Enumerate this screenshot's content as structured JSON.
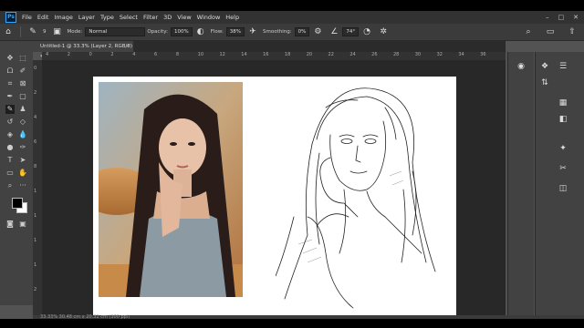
{
  "app": {
    "logo_text": "Ps",
    "menu": [
      "File",
      "Edit",
      "Image",
      "Layer",
      "Type",
      "Select",
      "Filter",
      "3D",
      "View",
      "Window",
      "Help"
    ],
    "window_controls": [
      "–",
      "□",
      "✕"
    ]
  },
  "options": {
    "brush_size": "9",
    "mode_label": "Mode:",
    "mode_value": "Normal",
    "opacity_label": "Opacity:",
    "opacity_value": "100%",
    "flow_label": "Flow:",
    "flow_value": "38%",
    "smoothing_label": "Smoothing:",
    "smoothing_value": "0%",
    "angle_value": "74°"
  },
  "document": {
    "tab_title": "Untitled-1 @ 33.3% (Layer 2, RGB/8) *",
    "tab_close": "×"
  },
  "ruler": {
    "top_ticks": [
      "4",
      "2",
      "0",
      "2",
      "4",
      "6",
      "8",
      "10",
      "12",
      "14",
      "16",
      "18",
      "20",
      "22",
      "24",
      "26",
      "28",
      "30",
      "32",
      "34",
      "36"
    ],
    "left_ticks": [
      "0",
      "2",
      "4",
      "6",
      "8",
      "1",
      "1",
      "1",
      "1",
      "2"
    ]
  },
  "status": {
    "text": "33.33%    30.48 cm x 20.32 cm (300 ppi)"
  },
  "icons": {
    "home": "home-icon",
    "brush": "brush-icon",
    "pressure": "pressure-icon",
    "airbrush": "airbrush-icon",
    "settings": "gear-icon",
    "symmetry": "butterfly-icon"
  }
}
